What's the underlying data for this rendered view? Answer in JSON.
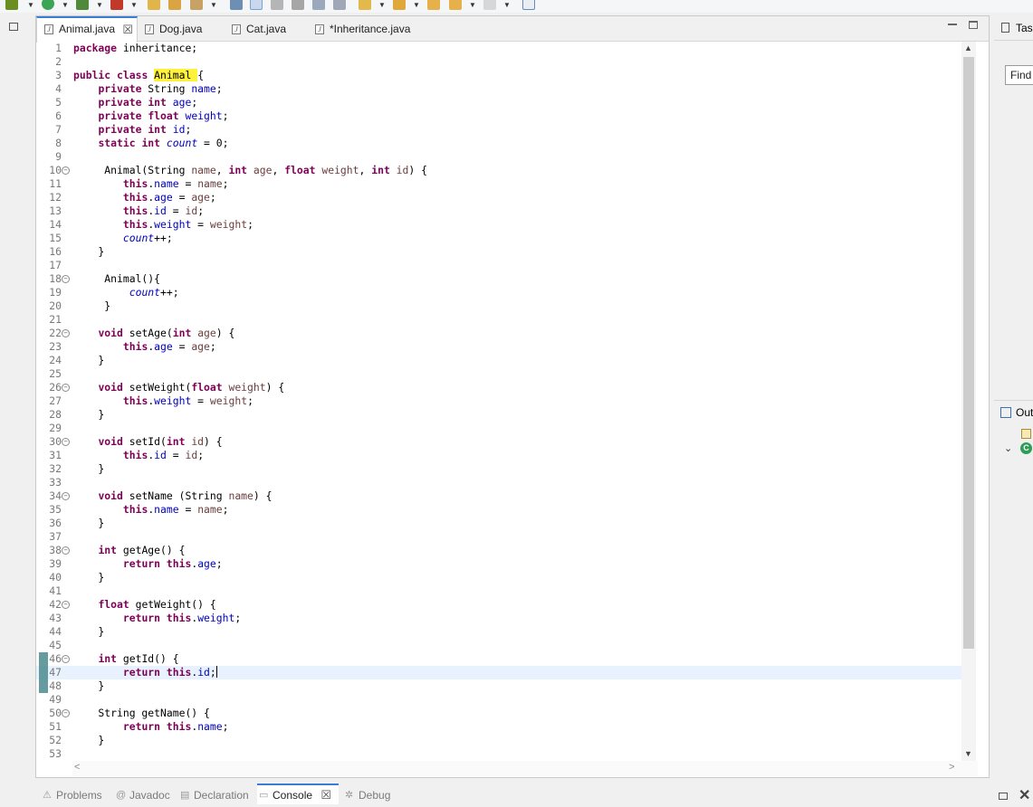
{
  "toolbar": {
    "icons": [
      "debug-icon",
      "run-icon",
      "external-tools-icon",
      "new-class-icon",
      "open-type-icon",
      "open-task-icon",
      "search-icon",
      "next-annotation-icon",
      "toggle-mark-occurrences-icon",
      "toggle-block-selection-icon",
      "show-whitespace-icon",
      "pin-editor-icon",
      "prev-annotation-icon",
      "next-edit-icon",
      "back-icon",
      "forward-icon",
      "perspective-icon"
    ]
  },
  "editor": {
    "tabs": [
      {
        "label": "Animal.java",
        "active": true
      },
      {
        "label": "Dog.java",
        "active": false
      },
      {
        "label": "Cat.java",
        "active": false
      },
      {
        "label": "*Inheritance.java",
        "active": false
      }
    ],
    "tab_icon_glyph": "J",
    "close_glyph": "☒",
    "lines": [
      {
        "n": "1",
        "html": "<span class=\"kw\">package</span> inheritance;"
      },
      {
        "n": "2",
        "html": ""
      },
      {
        "n": "3",
        "html": "<span class=\"kw\">public</span> <span class=\"kw\">class</span> <span class=\"hl\">Animal </span>{"
      },
      {
        "n": "4",
        "html": "    <span class=\"kw\">private</span> String <span class=\"fld\">name</span>;"
      },
      {
        "n": "5",
        "html": "    <span class=\"kw\">private</span> <span class=\"kw\">int</span> <span class=\"fld\">age</span>;"
      },
      {
        "n": "6",
        "html": "    <span class=\"kw\">private</span> <span class=\"kw\">float</span> <span class=\"fld\">weight</span>;"
      },
      {
        "n": "7",
        "html": "    <span class=\"kw\">private</span> <span class=\"kw\">int</span> <span class=\"fld\">id</span>;"
      },
      {
        "n": "8",
        "html": "    <span class=\"kw\">static</span> <span class=\"kw\">int</span> <span class=\"stat\">count</span> = 0;"
      },
      {
        "n": "9",
        "html": ""
      },
      {
        "n": "10",
        "fold": true,
        "html": "     Animal(String <span class=\"prm\">name</span>, <span class=\"kw\">int</span> <span class=\"prm\">age</span>, <span class=\"kw\">float</span> <span class=\"prm\">weight</span>, <span class=\"kw\">int</span> <span class=\"prm\">id</span>) {"
      },
      {
        "n": "11",
        "html": "        <span class=\"kw\">this</span>.<span class=\"fld\">name</span> = <span class=\"prm\">name</span>;"
      },
      {
        "n": "12",
        "html": "        <span class=\"kw\">this</span>.<span class=\"fld\">age</span> = <span class=\"prm\">age</span>;"
      },
      {
        "n": "13",
        "html": "        <span class=\"kw\">this</span>.<span class=\"fld\">id</span> = <span class=\"prm\">id</span>;"
      },
      {
        "n": "14",
        "html": "        <span class=\"kw\">this</span>.<span class=\"fld\">weight</span> = <span class=\"prm\">weight</span>;"
      },
      {
        "n": "15",
        "html": "        <span class=\"stat\">count</span>++;"
      },
      {
        "n": "16",
        "html": "    }"
      },
      {
        "n": "17",
        "html": ""
      },
      {
        "n": "18",
        "fold": true,
        "html": "     Animal(){"
      },
      {
        "n": "19",
        "html": "         <span class=\"stat\">count</span>++;"
      },
      {
        "n": "20",
        "html": "     }"
      },
      {
        "n": "21",
        "html": ""
      },
      {
        "n": "22",
        "fold": true,
        "html": "    <span class=\"kw\">void</span> setAge(<span class=\"kw\">int</span> <span class=\"prm\">age</span>) {"
      },
      {
        "n": "23",
        "html": "        <span class=\"kw\">this</span>.<span class=\"fld\">age</span> = <span class=\"prm\">age</span>;"
      },
      {
        "n": "24",
        "html": "    }"
      },
      {
        "n": "25",
        "html": ""
      },
      {
        "n": "26",
        "fold": true,
        "html": "    <span class=\"kw\">void</span> setWeight(<span class=\"kw\">float</span> <span class=\"prm\">weight</span>) {"
      },
      {
        "n": "27",
        "html": "        <span class=\"kw\">this</span>.<span class=\"fld\">weight</span> = <span class=\"prm\">weight</span>;"
      },
      {
        "n": "28",
        "html": "    }"
      },
      {
        "n": "29",
        "html": ""
      },
      {
        "n": "30",
        "fold": true,
        "html": "    <span class=\"kw\">void</span> setId(<span class=\"kw\">int</span> <span class=\"prm\">id</span>) {"
      },
      {
        "n": "31",
        "html": "        <span class=\"kw\">this</span>.<span class=\"fld\">id</span> = <span class=\"prm\">id</span>;"
      },
      {
        "n": "32",
        "html": "    }"
      },
      {
        "n": "33",
        "html": ""
      },
      {
        "n": "34",
        "fold": true,
        "html": "    <span class=\"kw\">void</span> setName (String <span class=\"prm\">name</span>) {"
      },
      {
        "n": "35",
        "html": "        <span class=\"kw\">this</span>.<span class=\"fld\">name</span> = <span class=\"prm\">name</span>;"
      },
      {
        "n": "36",
        "html": "    }"
      },
      {
        "n": "37",
        "html": ""
      },
      {
        "n": "38",
        "fold": true,
        "html": "    <span class=\"kw\">int</span> getAge() {"
      },
      {
        "n": "39",
        "html": "        <span class=\"kw\">return</span> <span class=\"kw\">this</span>.<span class=\"fld\">age</span>;"
      },
      {
        "n": "40",
        "html": "    }"
      },
      {
        "n": "41",
        "html": ""
      },
      {
        "n": "42",
        "fold": true,
        "html": "    <span class=\"kw\">float</span> getWeight() {"
      },
      {
        "n": "43",
        "html": "        <span class=\"kw\">return</span> <span class=\"kw\">this</span>.<span class=\"fld\">weight</span>;"
      },
      {
        "n": "44",
        "html": "    }"
      },
      {
        "n": "45",
        "html": ""
      },
      {
        "n": "46",
        "fold": true,
        "marker": true,
        "html": "    <span class=\"kw\">int</span> getId() {"
      },
      {
        "n": "47",
        "marker": true,
        "current": true,
        "html": "        <span class=\"kw\">return</span> <span class=\"kw\">this</span>.<span class=\"fld\">id</span>;<span class=\"caret\"></span>"
      },
      {
        "n": "48",
        "marker": true,
        "html": "    }"
      },
      {
        "n": "49",
        "html": ""
      },
      {
        "n": "50",
        "fold": true,
        "html": "    String getName() {"
      },
      {
        "n": "51",
        "html": "        <span class=\"kw\">return</span> <span class=\"kw\">this</span>.<span class=\"fld\">name</span>;"
      },
      {
        "n": "52",
        "html": "    }"
      },
      {
        "n": "53",
        "html": ""
      }
    ]
  },
  "right_panel": {
    "task_tab_label": "Task List",
    "find_placeholder": "Find",
    "outline_tab_label": "Outline",
    "outline_class_glyph": "C"
  },
  "bottom_tabs": [
    {
      "label": "Problems",
      "icon": "problems-icon",
      "glyph": "⚠",
      "active": false
    },
    {
      "label": "Javadoc",
      "icon": "javadoc-icon",
      "glyph": "@",
      "active": false
    },
    {
      "label": "Declaration",
      "icon": "declaration-icon",
      "glyph": "▤",
      "active": false
    },
    {
      "label": "Console",
      "icon": "console-icon",
      "glyph": "▭",
      "active": true
    },
    {
      "label": "Debug",
      "icon": "debug-icon",
      "glyph": "✲",
      "active": false
    }
  ],
  "colors": {
    "keyword": "#7f0055",
    "field": "#0000c0",
    "parameter": "#6a3e3e",
    "highlight": "#fff23b",
    "current_line": "#e8f2fe",
    "active_tab_accent": "#3d7bd8"
  }
}
